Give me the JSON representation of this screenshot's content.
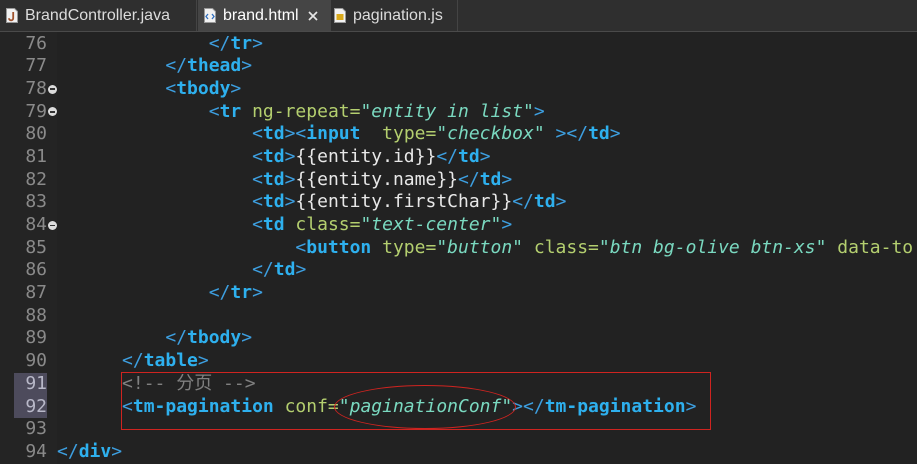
{
  "tabs": [
    {
      "label": "BrandController.java",
      "icon": "java-file-icon",
      "active": false
    },
    {
      "label": "brand.html",
      "icon": "html-file-icon",
      "active": true,
      "close_icon": "close-icon"
    },
    {
      "label": "pagination.js",
      "icon": "js-file-icon",
      "active": false
    }
  ],
  "editor": {
    "fold_icon": "fold-collapse-icon",
    "syntax_colors": {
      "delimiter": "#3d9fe0",
      "tag_name": "#2eb0ee",
      "attribute_name": "#b4cf6f",
      "attribute_value": "#7ad9c0",
      "text": "#e8e8e8",
      "comment": "#808080"
    },
    "lines": [
      {
        "number": "76",
        "tokens": [
          {
            "delimiter": "              </"
          },
          {
            "tag_name": "tr"
          },
          {
            "delimiter": ">"
          }
        ]
      },
      {
        "number": "77",
        "tokens": [
          {
            "delimiter": "          </"
          },
          {
            "tag_name": "thead"
          },
          {
            "delimiter": ">"
          }
        ]
      },
      {
        "number": "78",
        "fold": true,
        "tokens": [
          {
            "delimiter": "          <"
          },
          {
            "tag_name": "tbody"
          },
          {
            "delimiter": ">"
          }
        ]
      },
      {
        "number": "79",
        "fold": true,
        "tokens": [
          {
            "delimiter": "              <"
          },
          {
            "tag_name": "tr"
          },
          {
            "attribute_name": " ng-repeat="
          },
          {
            "attribute_value": "\"entity in list\""
          },
          {
            "delimiter": ">"
          }
        ]
      },
      {
        "number": "80",
        "tokens": [
          {
            "delimiter": "                  <"
          },
          {
            "tag_name": "td"
          },
          {
            "delimiter": "><"
          },
          {
            "tag_name": "input"
          },
          {
            "attribute_name": "  type="
          },
          {
            "attribute_value": "\"checkbox\""
          },
          {
            "delimiter": " ></"
          },
          {
            "tag_name": "td"
          },
          {
            "delimiter": ">"
          }
        ]
      },
      {
        "number": "81",
        "tokens": [
          {
            "delimiter": "                  <"
          },
          {
            "tag_name": "td"
          },
          {
            "delimiter": ">"
          },
          {
            "text": "{{entity.id}}"
          },
          {
            "delimiter": "</"
          },
          {
            "tag_name": "td"
          },
          {
            "delimiter": ">"
          }
        ]
      },
      {
        "number": "82",
        "tokens": [
          {
            "delimiter": "                  <"
          },
          {
            "tag_name": "td"
          },
          {
            "delimiter": ">"
          },
          {
            "text": "{{entity.name}}"
          },
          {
            "delimiter": "</"
          },
          {
            "tag_name": "td"
          },
          {
            "delimiter": ">"
          }
        ]
      },
      {
        "number": "83",
        "tokens": [
          {
            "delimiter": "                  <"
          },
          {
            "tag_name": "td"
          },
          {
            "delimiter": ">"
          },
          {
            "text": "{{entity.firstChar}}"
          },
          {
            "delimiter": "</"
          },
          {
            "tag_name": "td"
          },
          {
            "delimiter": ">"
          }
        ]
      },
      {
        "number": "84",
        "fold": true,
        "tokens": [
          {
            "delimiter": "                  <"
          },
          {
            "tag_name": "td"
          },
          {
            "attribute_name": " class="
          },
          {
            "attribute_value": "\"text-center\""
          },
          {
            "delimiter": ">"
          }
        ]
      },
      {
        "number": "85",
        "tokens": [
          {
            "delimiter": "                      <"
          },
          {
            "tag_name": "button"
          },
          {
            "attribute_name": " type="
          },
          {
            "attribute_value": "\"button\""
          },
          {
            "attribute_name": " class="
          },
          {
            "attribute_value": "\"btn bg-olive btn-xs\""
          },
          {
            "attribute_name": " data-to"
          }
        ]
      },
      {
        "number": "86",
        "tokens": [
          {
            "delimiter": "                  </"
          },
          {
            "tag_name": "td"
          },
          {
            "delimiter": ">"
          }
        ]
      },
      {
        "number": "87",
        "tokens": [
          {
            "delimiter": "              </"
          },
          {
            "tag_name": "tr"
          },
          {
            "delimiter": ">"
          }
        ]
      },
      {
        "number": "88",
        "tokens": []
      },
      {
        "number": "89",
        "tokens": [
          {
            "delimiter": "          </"
          },
          {
            "tag_name": "tbody"
          },
          {
            "delimiter": ">"
          }
        ]
      },
      {
        "number": "90",
        "tokens": [
          {
            "delimiter": "      </"
          },
          {
            "tag_name": "table"
          },
          {
            "delimiter": ">"
          }
        ]
      },
      {
        "number": "91",
        "highlighted": true,
        "tokens": [
          {
            "comment": "      <!-- 分页 -->"
          }
        ]
      },
      {
        "number": "92",
        "highlighted": true,
        "tokens": [
          {
            "delimiter": "      <"
          },
          {
            "tag_name": "tm-pagination"
          },
          {
            "attribute_name": " conf="
          },
          {
            "attribute_value": "\"paginationConf\""
          },
          {
            "delimiter": "></"
          },
          {
            "tag_name": "tm-pagination"
          },
          {
            "delimiter": ">"
          }
        ]
      },
      {
        "number": "93",
        "tokens": []
      },
      {
        "number": "94",
        "tokens": [
          {
            "delimiter": "</"
          },
          {
            "tag_name": "div"
          },
          {
            "delimiter": ">"
          }
        ]
      }
    ]
  },
  "annotation_color": "#cf2420"
}
